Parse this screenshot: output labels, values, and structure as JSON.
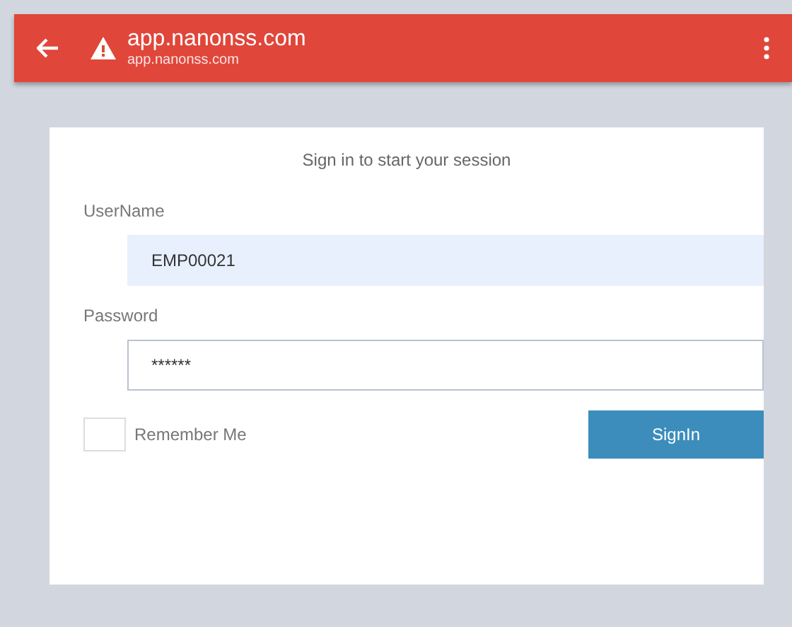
{
  "address_bar": {
    "title": "app.nanonss.com",
    "subtitle": "app.nanonss.com"
  },
  "login": {
    "heading": "Sign in to start your session",
    "username": {
      "label": "UserName",
      "value": "EMP00021"
    },
    "password": {
      "label": "Password",
      "value": "******"
    },
    "remember": {
      "label": "Remember Me",
      "checked": false
    },
    "button": "SignIn"
  }
}
